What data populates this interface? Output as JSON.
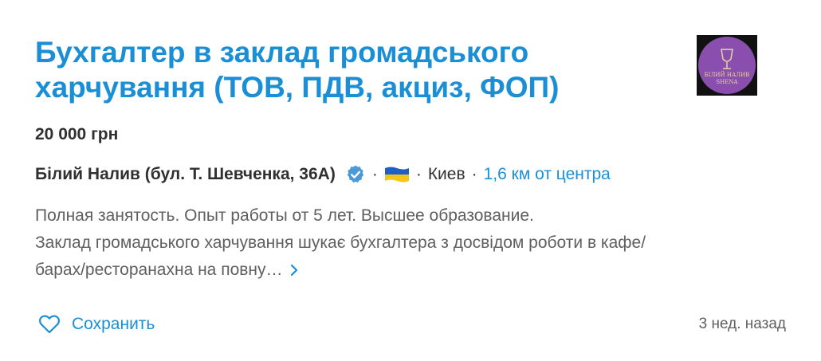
{
  "vacancy": {
    "title": "Бухгалтер в заклад громадського харчування (ТОВ, ПДВ, акциз, ФОП)",
    "salary": "20 000 грн",
    "company": "Білий Налив (бул. Т. Шевченка, 36А)",
    "verified_icon": "verified-check-icon",
    "flag_icon": "ukraine-flag-icon",
    "separator": "·",
    "city": "Киев",
    "distance": "1,6 км от центра",
    "description_line1": "Полная занятость. Опыт работы от 5 лет. Высшее образование.",
    "description_line2": "Заклад громадського харчування шукає бухгалтера з досвідом роботи в кафе/",
    "description_line3": "барах/ресторанахна на повну…",
    "more_icon": "chevron-right-icon",
    "save_label": "Сохранить",
    "save_icon": "heart-outline-icon",
    "posted": "3 нед. назад",
    "logo_text_line1": "БІЛИЙ НАЛИВ",
    "logo_text_line2": "SHENA"
  },
  "colors": {
    "accent": "#1a8fd6",
    "text": "#303030",
    "muted": "#5f5f5f",
    "logo_bg": "#8a4fae",
    "verified": "#4a9ad8",
    "flag_blue": "#1f5fc8",
    "flag_yellow": "#f5c518"
  }
}
